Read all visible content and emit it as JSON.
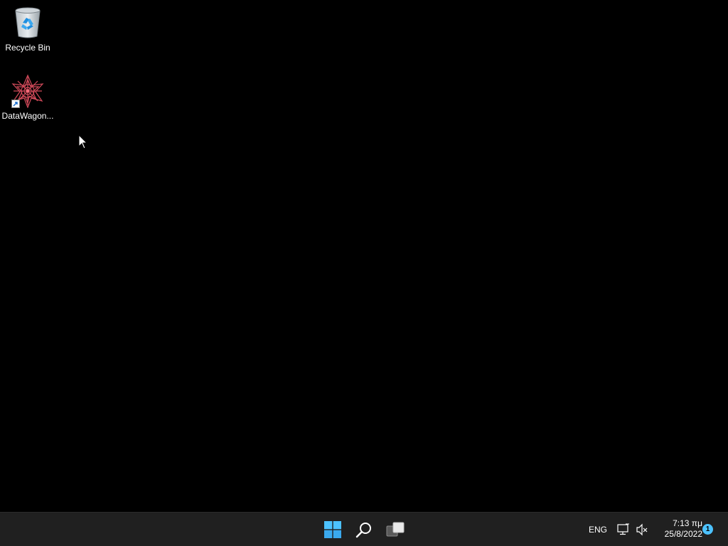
{
  "desktop": {
    "icons": [
      {
        "label": "Recycle Bin",
        "icon": "recycle-bin-icon"
      },
      {
        "label": "DataWagon...",
        "icon": "datawagon-app-icon",
        "shortcut": true
      }
    ]
  },
  "taskbar": {
    "buttons": [
      {
        "name": "start",
        "icon": "windows-logo-icon"
      },
      {
        "name": "search",
        "icon": "search-icon"
      },
      {
        "name": "task-view",
        "icon": "task-view-icon"
      }
    ],
    "tray": {
      "language": "ENG",
      "network_icon": "network-icon",
      "volume_icon": "volume-muted-icon",
      "time": "7:13 πμ",
      "date": "25/8/2022",
      "notification_count": "1"
    }
  },
  "colors": {
    "desktop_bg": "#000000",
    "taskbar_bg": "#202020",
    "windows_logo": "#4cc2ff",
    "notification_badge": "#4cc2ff"
  }
}
